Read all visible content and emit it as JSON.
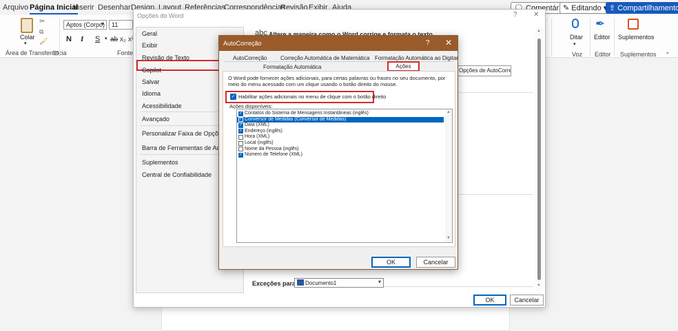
{
  "ribbon": {
    "tabs": [
      "Arquivo",
      "Página Inicial",
      "Inserir",
      "Desenhar",
      "Design",
      "Layout",
      "Referências",
      "Correspondências",
      "Revisão",
      "Exibir",
      "Ajuda"
    ],
    "comments_label": "Comentários",
    "editing_label": "Editando",
    "share_label": "Compartilhamento",
    "paste_label": "Colar",
    "clipboard_group": "Área de Transferência",
    "font_group": "Fonte",
    "font_name": "Aptos (Corpo)",
    "font_size": "11",
    "bold": "N",
    "italic": "I",
    "underline": "S",
    "dictate_label": "Ditar",
    "voice_group": "Voz",
    "editor_label": "Editor",
    "editor_group": "Editor",
    "addins_label": "Suplementos",
    "addins_group": "Suplementos"
  },
  "options_dialog": {
    "title": "Opções do Word",
    "help": "?",
    "close": "✕",
    "nav": [
      "Geral",
      "Exibir",
      "Revisão de Texto",
      "Copilot",
      "Salvar",
      "Idioma",
      "Acessibilidade",
      "Avançado",
      "Personalizar Faixa de Opções",
      "Barra de Ferramentas de Acesso Rápido",
      "Suplementos",
      "Central de Confiabilidade"
    ],
    "abc": "abc",
    "description": "Altere a maneira como o Word corrige e formata o texto.",
    "autocorrect_button": "Opções de AutoCorreção...",
    "exceptions_label": "Exceções para:",
    "exceptions_value": "Documento1",
    "ok": "OK",
    "cancel": "Cancelar"
  },
  "autocorrect_dialog": {
    "title": "AutoCorreção",
    "help": "?",
    "close": "✕",
    "tabs_row1": [
      "AutoCorreção",
      "Correção Automática de Matemática",
      "Formatação Automática ao Digitar"
    ],
    "tabs_row2": [
      "Formatação Automática",
      "Ações"
    ],
    "intro": "O Word pode fornecer ações adicionais, para certas palavras ou frases no seu documento, por meio do menu acessado com um clique usando o botão direito do mouse.",
    "enable_label": "Habilitar ações adicionais no menu de clique com o botão direito",
    "enable_checked": true,
    "list_label": "Ações disponíveis:",
    "actions": [
      {
        "label": "Contatos do Sistema de Mensagens Instantâneas (inglês)",
        "checked": true
      },
      {
        "label": "Conversor de Medidas (Conversor de Medidas)",
        "checked": true,
        "selected": true
      },
      {
        "label": "Data (XML)",
        "checked": true
      },
      {
        "label": "Endereço (inglês)",
        "checked": true
      },
      {
        "label": "Hora (XML)",
        "checked": false
      },
      {
        "label": "Local (inglês)",
        "checked": false
      },
      {
        "label": "Nome da Pessoa (inglês)",
        "checked": false
      },
      {
        "label": "Número de Telefone (XML)",
        "checked": true
      }
    ],
    "ok": "OK",
    "cancel": "Cancelar"
  }
}
